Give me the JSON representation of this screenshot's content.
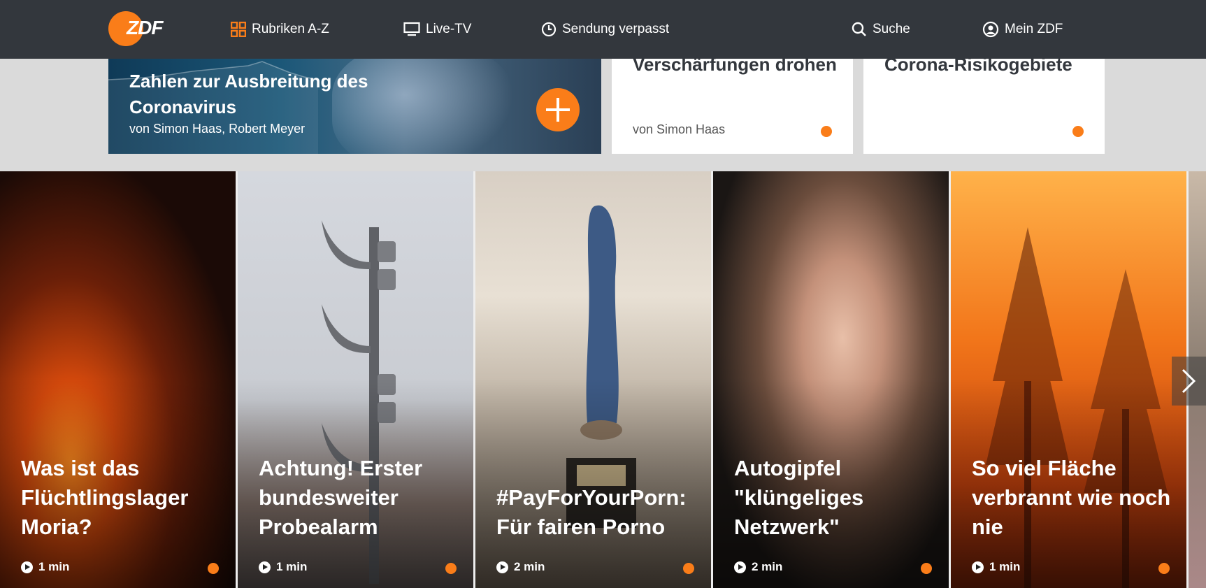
{
  "header": {
    "logo_text": "ZDF",
    "nav": [
      {
        "label": "Rubriken A-Z",
        "icon": "grid-icon"
      },
      {
        "label": "Live-TV",
        "icon": "monitor-icon"
      },
      {
        "label": "Sendung verpasst",
        "icon": "clock-icon"
      },
      {
        "label": "Suche",
        "icon": "search-icon"
      },
      {
        "label": "Mein ZDF",
        "icon": "user-icon"
      }
    ]
  },
  "teasers": {
    "main": {
      "title": "Zahlen zur Ausbreitung des Coronavirus",
      "author": "von Simon Haas, Robert Meyer"
    },
    "card1": {
      "title": "Verschärfungen drohen",
      "author": "von Simon Haas"
    },
    "card2": {
      "title": "Corona-Risikogebiete",
      "author": ""
    }
  },
  "videos": [
    {
      "title": "Was ist das Flüchtlingslager Moria?",
      "duration": "1 min"
    },
    {
      "title": "Achtung! Erster bundesweiter Probealarm",
      "duration": "1 min"
    },
    {
      "title": "#PayForYourPorn: Für fairen Porno",
      "duration": "2 min"
    },
    {
      "title": "Autogipfel \"klüngeliges Netzwerk\"",
      "duration": "2 min"
    },
    {
      "title": "So viel Fläche verbrannt wie noch nie",
      "duration": "1 min"
    }
  ],
  "colors": {
    "header_bg": "#33373d",
    "accent": "#fa7d19",
    "page_bg": "#dadada"
  }
}
